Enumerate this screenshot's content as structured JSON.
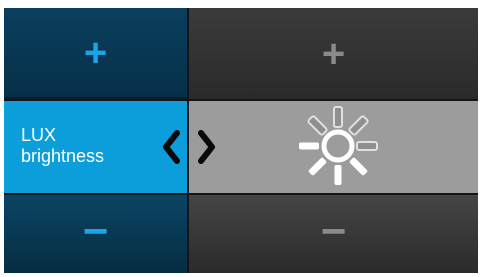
{
  "increase": {
    "label": "+",
    "icon": "plus-icon"
  },
  "decrease": {
    "label": "−",
    "icon": "minus-icon"
  },
  "setting": {
    "line1": "LUX",
    "line2": "brightness",
    "icon": "sun-icon"
  },
  "colors": {
    "accent": "#0c9ddb",
    "accent_dark": "#063049",
    "plus_blue": "#1aa6e6",
    "value_bg": "#9c9c9c",
    "dark_bg": "#2a2a2a"
  }
}
